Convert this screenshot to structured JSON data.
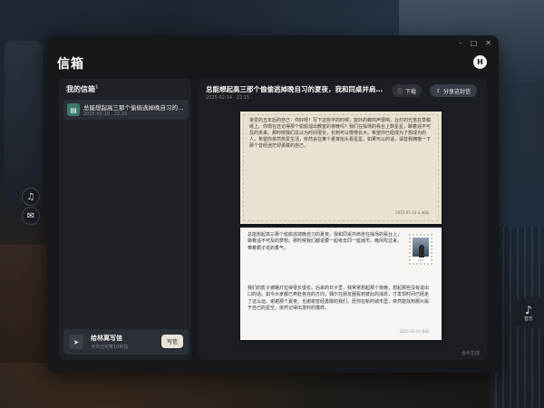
{
  "window": {
    "title": "信箱",
    "avatar_letter": "H",
    "controls": [
      "–",
      "□",
      "✕"
    ]
  },
  "left_panel": {
    "title": "我的信箱",
    "count": "1",
    "letters": [
      {
        "title": "总能想起高三那个偷偷逃掉晚自习的夏夜，我和同桌并…",
        "date": "2025-05-10 · 22:15",
        "icon": "book-icon"
      }
    ],
    "write_card": {
      "title": "给林离写信",
      "subtitle": "今天还可寄10封信",
      "button": "写信",
      "icon": "paper-plane-icon"
    }
  },
  "right_panel": {
    "title": "总能想起高三那个偷偷逃掉晚自习的夏夜，我和同桌并肩…",
    "date": "2025-02-14 · 22:15",
    "download_label": "下载",
    "share_label": "分享这封信",
    "ai_note": "含AI生成",
    "handwritten_letter": {
      "text": "亲爱的五年后的自己：你好呀！写下这些字的时候，窗外的蝉鸣声很响，台灯的光落在草稿纸上。你现在还记得那个偷偷溜出教室的夜晚吗？我们在操场的看台上数星星，聊着遥不可及的未来。那时候我们总以为时间很长，长到可以慢慢长大。希望你已经成为了想成为的人，希望你依然热爱生活，依然会在某个夏夜抬头看星星。如果可以的话，请替我拥抱一下那个曾经迷茫却勇敢的自己。",
      "date": "2025-05-10 & 林离"
    },
    "typed_letter": {
      "text_top": "总能想起高三那个偷偷逃掉晚自习的夏夜，我和同桌并肩坐在操场的看台上，聊着遥不可及的梦想。那时候我们都说要一起考去同一座城市，晚风吹过来，带着栀子花的香气，",
      "text_rest": "我们的影子被路灯拉得很长很长。后来的日子里，我常常想起那个夜晚，想起那些没有说出口的话。如今大家都已奔赴各自的方向，偶尔在朋友圈看到彼此的消息，才发现时间已经走了这么远。谢谢那个夏夜，也谢谢曾经勇敢的我们。愿你在新的城市里，依然能找到那片属于自己的星空，依然记得出发时的模样。",
      "date": "2025-05-10 林离",
      "stamp_caption": "林离"
    }
  },
  "sidebar_icons": {
    "music": "♫",
    "notify": "✉"
  },
  "music_float": {
    "label": "音乐",
    "icon": "♪"
  }
}
